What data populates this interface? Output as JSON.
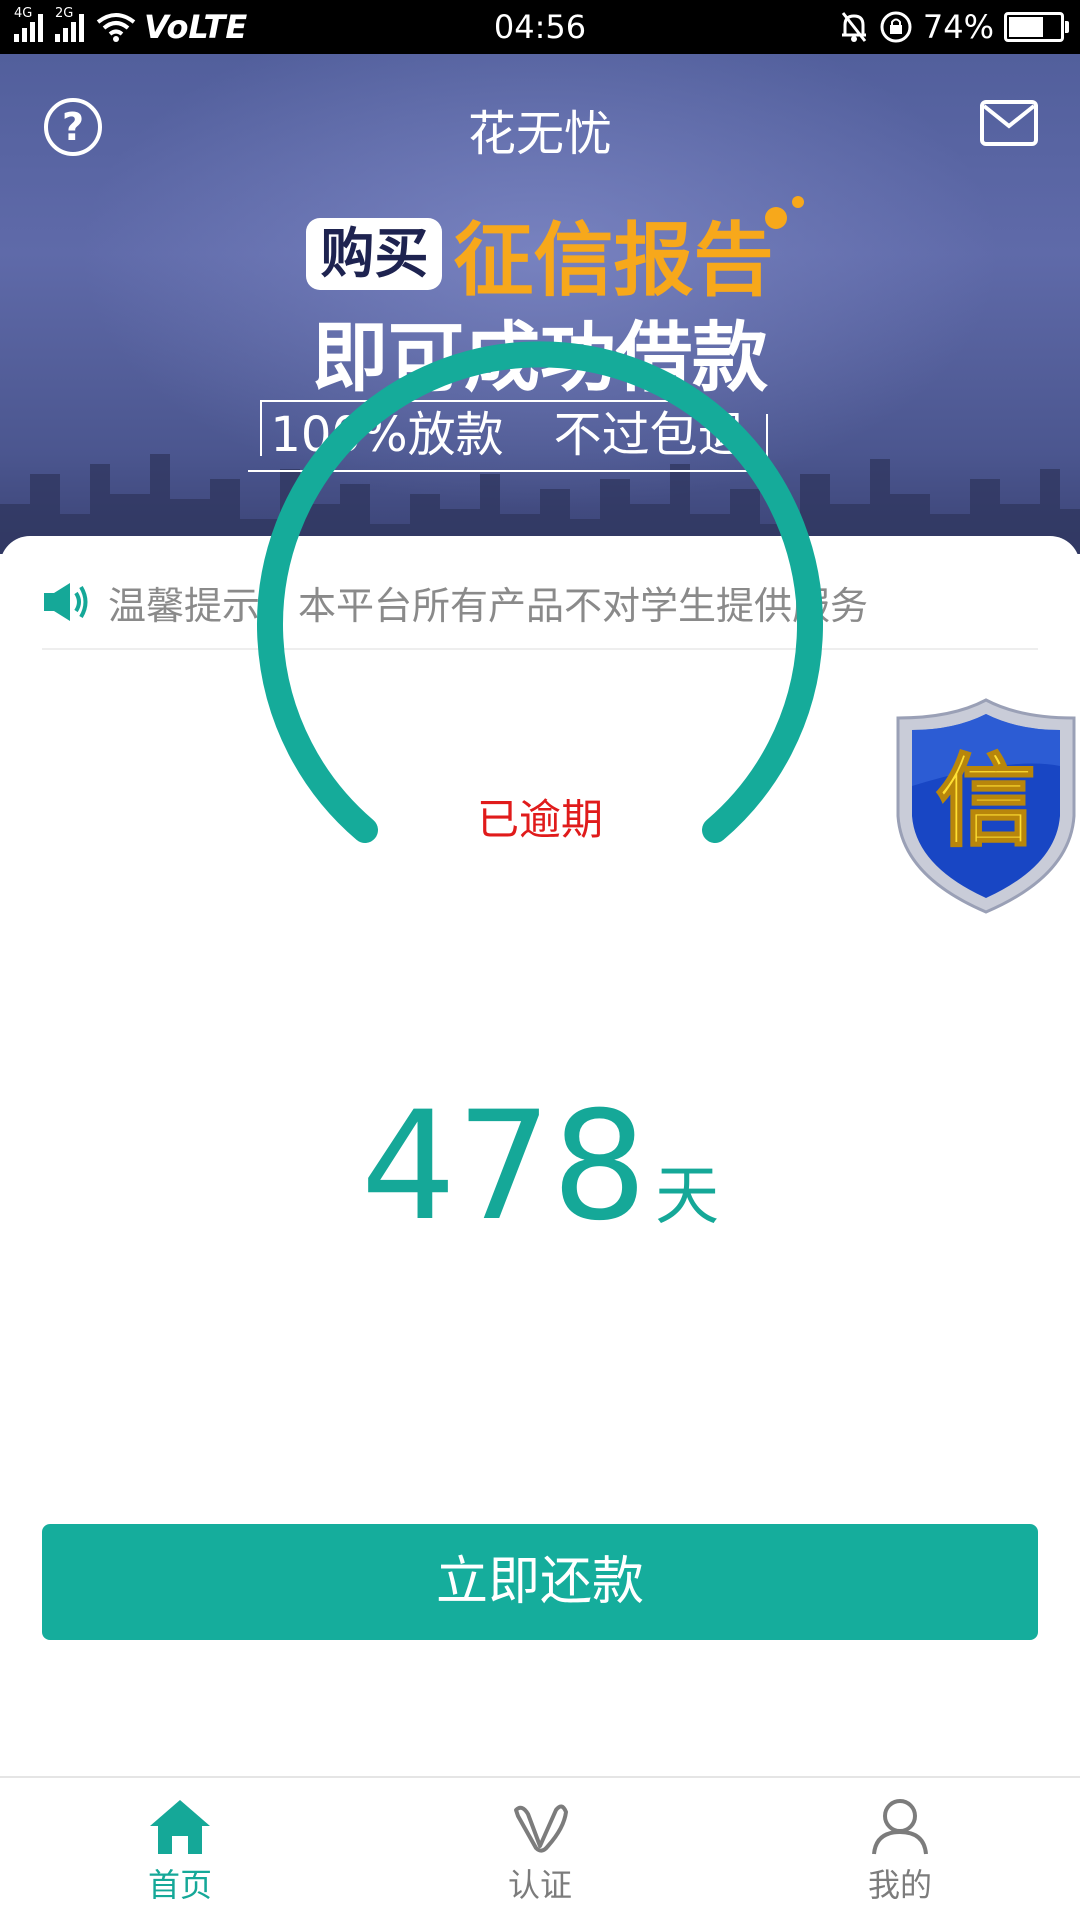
{
  "status_bar": {
    "network_1": "4G",
    "network_2": "2G",
    "volte": "VoLTE",
    "time": "04:56",
    "battery": "74%",
    "battery_level": 0.74
  },
  "header": {
    "title": "花无忧",
    "help_icon": "help-circle-icon",
    "mail_icon": "mail-icon"
  },
  "banner": {
    "buy_tag": "购买",
    "headline_highlight": "征信报告",
    "headline2": "即可成功借款",
    "slogan_a": "100%放款",
    "slogan_b": "不过包退"
  },
  "notice": {
    "text": "温馨提示：本平台所有产品不对学生提供服务",
    "icon": "speaker-icon"
  },
  "badge": {
    "char": "信"
  },
  "loan": {
    "status": "已逾期",
    "days": "478",
    "unit": "天"
  },
  "actions": {
    "repay_label": "立即还款"
  },
  "nav": {
    "items": [
      {
        "label": "首页",
        "icon": "home-icon",
        "active": true
      },
      {
        "label": "认证",
        "icon": "verify-icon",
        "active": false
      },
      {
        "label": "我的",
        "icon": "user-icon",
        "active": false
      }
    ]
  },
  "colors": {
    "accent": "#15a898",
    "overdue": "#e01b1b",
    "banner_bg": "#5a65a3",
    "promo_gold": "#f7a81b"
  }
}
